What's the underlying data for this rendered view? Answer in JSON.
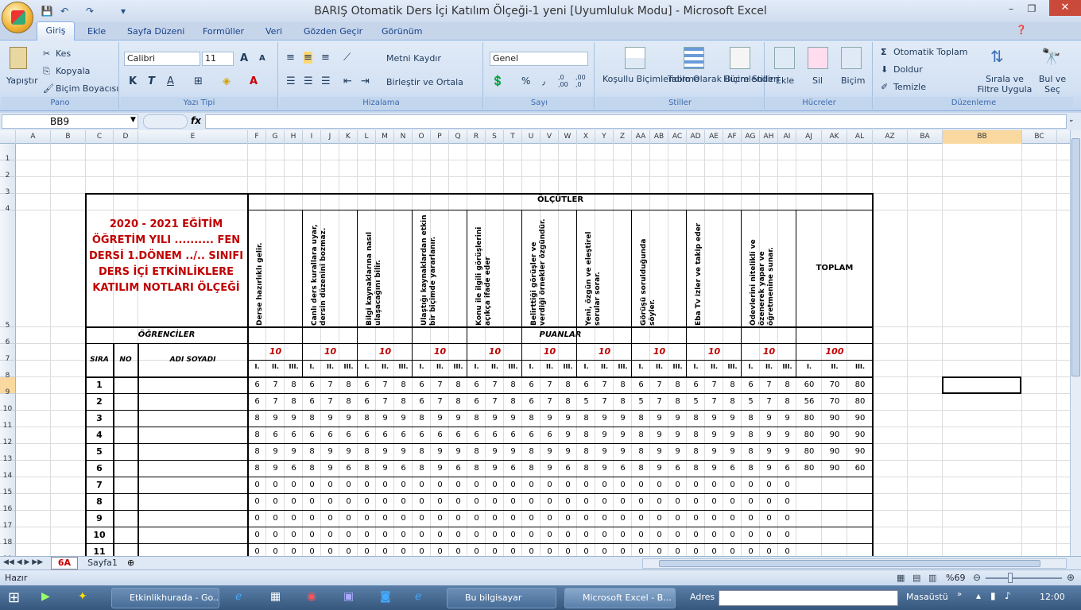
{
  "window": {
    "title": "BARIŞ Otomatik Ders İçi Katılım Ölçeği-1 yeni  [Uyumluluk Modu]  - Microsoft Excel",
    "minimize": "–",
    "restore": "❐",
    "close": "✕"
  },
  "ribbon_tabs": [
    "Giriş",
    "Ekle",
    "Sayfa Düzeni",
    "Formüller",
    "Veri",
    "Gözden Geçir",
    "Görünüm"
  ],
  "ribbon": {
    "clipboard": {
      "paste": "Yapıştır",
      "cut": "Kes",
      "copy": "Kopyala",
      "format_painter": "Biçim Boyacısı",
      "label": "Pano"
    },
    "font": {
      "name": "Calibri",
      "size": "11",
      "bold": "K",
      "italic": "T",
      "underline": "A",
      "color": "A",
      "grow": "A",
      "shrink": "A",
      "label": "Yazı Tipi"
    },
    "alignment": {
      "wrap": "Metni Kaydır",
      "merge": "Birleştir ve Ortala",
      "label": "Hizalama"
    },
    "number": {
      "format": "Genel",
      "percent": "%",
      "comma": "٫",
      "inc": ",0 ,00",
      "dec": ",00 ,0",
      "label": "Sayı"
    },
    "styles": {
      "conditional": "Koşullu Biçimlendirme",
      "table": "Tablo Olarak Biçimlendir",
      "cell": "Hücre Stilleri",
      "label": "Stiller"
    },
    "cells": {
      "insert": "Ekle",
      "delete": "Sil",
      "format": "Biçim",
      "label": "Hücreler"
    },
    "editing": {
      "autosum": "Otomatik Toplam",
      "fill": "Doldur",
      "clear": "Temizle",
      "sort": "Sırala ve Filtre Uygula",
      "find": "Bul ve Seç",
      "label": "Düzenleme"
    }
  },
  "formula_bar": {
    "name_box": "BB9",
    "fx": "fx",
    "formula": ""
  },
  "columns": [
    "A",
    "B",
    "C",
    "D",
    "E",
    "F",
    "G",
    "H",
    "I",
    "J",
    "K",
    "L",
    "M",
    "N",
    "O",
    "P",
    "Q",
    "R",
    "S",
    "T",
    "U",
    "V",
    "W",
    "X",
    "Y",
    "Z",
    "AA",
    "AB",
    "AC",
    "AD",
    "AE",
    "AF",
    "AG",
    "AH",
    "AI",
    "AJ",
    "AK",
    "AL",
    "AZ",
    "BA",
    "BB",
    "BC"
  ],
  "rows": [
    "1",
    "2",
    "3",
    "4",
    "5",
    "6",
    "7",
    "8",
    "9",
    "10",
    "11",
    "12",
    "13",
    "14",
    "15",
    "16",
    "17",
    "18",
    "19"
  ],
  "sheet": {
    "title_block": "2020 - 2021 EĞİTİM ÖĞRETİM YILI ..........  FEN DERSİ 1.DÖNEM ../.. SINIFI DERS İÇİ ETKİNLİKLERE KATILIM NOTLARI ÖLÇEĞİ",
    "olcutler": "ÖLÇÜTLER",
    "criteria": [
      "Derse hazırlıklı gelir.",
      "Canlı ders kurallara uyar, dersin düzenini bozmaz.",
      "Bilgi kaynaklarına nasıl ulaşacağını bilir.",
      "Ulaştığı kaynaklardan etkin bir biçimde yararlanır.",
      "Konu ile ilgili görüşlerini açıkça ifade eder",
      "Belirttiği görüşler ve verdiği örnekler özgündür.",
      "Yeni, özgün ve eleştirel sorular sorar.",
      "Görüşü sorulduğunda söyler.",
      "Eba Tv izler ve takip eder",
      "Ödevlerini nitelikli ve özenerek yapar ve öğretmenine sunar."
    ],
    "toplam": "TOPLAM",
    "ogrenciler": "ÖĞRENCİLER",
    "puanlar": "PUANLAR",
    "max_points": [
      "10",
      "10",
      "10",
      "10",
      "10",
      "10",
      "10",
      "10",
      "10",
      "10",
      "100"
    ],
    "hdr_sira": "SIRA",
    "hdr_no": "NO",
    "hdr_adi": "ADI SOYADI",
    "sub": [
      "I.",
      "II.",
      "III."
    ],
    "students": [
      {
        "sira": "1",
        "scores": [
          "6",
          "7",
          "8",
          "6",
          "7",
          "8",
          "6",
          "7",
          "8",
          "6",
          "7",
          "8",
          "6",
          "7",
          "8",
          "6",
          "7",
          "8",
          "6",
          "7",
          "8",
          "6",
          "7",
          "8",
          "6",
          "7",
          "8",
          "6",
          "7",
          "8"
        ],
        "totals": [
          "60",
          "70",
          "80"
        ]
      },
      {
        "sira": "2",
        "scores": [
          "6",
          "7",
          "8",
          "6",
          "7",
          "8",
          "6",
          "7",
          "8",
          "6",
          "7",
          "8",
          "6",
          "7",
          "8",
          "6",
          "7",
          "8",
          "5",
          "7",
          "8",
          "5",
          "7",
          "8",
          "5",
          "7",
          "8",
          "5",
          "7",
          "8"
        ],
        "totals": [
          "56",
          "70",
          "80"
        ]
      },
      {
        "sira": "3",
        "scores": [
          "8",
          "9",
          "9",
          "8",
          "9",
          "9",
          "8",
          "9",
          "9",
          "8",
          "9",
          "9",
          "8",
          "9",
          "9",
          "8",
          "9",
          "9",
          "8",
          "9",
          "9",
          "8",
          "9",
          "9",
          "8",
          "9",
          "9",
          "8",
          "9",
          "9"
        ],
        "totals": [
          "80",
          "90",
          "90"
        ]
      },
      {
        "sira": "4",
        "scores": [
          "8",
          "6",
          "6",
          "6",
          "6",
          "6",
          "6",
          "6",
          "6",
          "6",
          "6",
          "6",
          "6",
          "6",
          "6",
          "6",
          "6",
          "9",
          "8",
          "9",
          "9",
          "8",
          "9",
          "9",
          "8",
          "9",
          "9",
          "8",
          "9",
          "9"
        ],
        "totals": [
          "80",
          "90",
          "90"
        ]
      },
      {
        "sira": "5",
        "scores": [
          "8",
          "9",
          "9",
          "8",
          "9",
          "9",
          "8",
          "9",
          "9",
          "8",
          "9",
          "9",
          "8",
          "9",
          "9",
          "8",
          "9",
          "9",
          "8",
          "9",
          "9",
          "8",
          "9",
          "9",
          "8",
          "9",
          "9",
          "8",
          "9",
          "9"
        ],
        "totals": [
          "80",
          "90",
          "90"
        ]
      },
      {
        "sira": "6",
        "scores": [
          "8",
          "9",
          "6",
          "8",
          "9",
          "6",
          "8",
          "9",
          "6",
          "8",
          "9",
          "6",
          "8",
          "9",
          "6",
          "8",
          "9",
          "6",
          "8",
          "9",
          "6",
          "8",
          "9",
          "6",
          "8",
          "9",
          "6",
          "8",
          "9",
          "6"
        ],
        "totals": [
          "80",
          "90",
          "60"
        ]
      },
      {
        "sira": "7",
        "scores": [
          "0",
          "0",
          "0",
          "0",
          "0",
          "0",
          "0",
          "0",
          "0",
          "0",
          "0",
          "0",
          "0",
          "0",
          "0",
          "0",
          "0",
          "0",
          "0",
          "0",
          "0",
          "0",
          "0",
          "0",
          "0",
          "0",
          "0",
          "0",
          "0",
          "0"
        ],
        "totals": [
          "",
          "",
          ""
        ]
      },
      {
        "sira": "8",
        "scores": [
          "0",
          "0",
          "0",
          "0",
          "0",
          "0",
          "0",
          "0",
          "0",
          "0",
          "0",
          "0",
          "0",
          "0",
          "0",
          "0",
          "0",
          "0",
          "0",
          "0",
          "0",
          "0",
          "0",
          "0",
          "0",
          "0",
          "0",
          "0",
          "0",
          "0"
        ],
        "totals": [
          "",
          "",
          ""
        ]
      },
      {
        "sira": "9",
        "scores": [
          "0",
          "0",
          "0",
          "0",
          "0",
          "0",
          "0",
          "0",
          "0",
          "0",
          "0",
          "0",
          "0",
          "0",
          "0",
          "0",
          "0",
          "0",
          "0",
          "0",
          "0",
          "0",
          "0",
          "0",
          "0",
          "0",
          "0",
          "0",
          "0",
          "0"
        ],
        "totals": [
          "",
          "",
          ""
        ]
      },
      {
        "sira": "10",
        "scores": [
          "0",
          "0",
          "0",
          "0",
          "0",
          "0",
          "0",
          "0",
          "0",
          "0",
          "0",
          "0",
          "0",
          "0",
          "0",
          "0",
          "0",
          "0",
          "0",
          "0",
          "0",
          "0",
          "0",
          "0",
          "0",
          "0",
          "0",
          "0",
          "0",
          "0"
        ],
        "totals": [
          "",
          "",
          ""
        ]
      },
      {
        "sira": "11",
        "scores": [
          "0",
          "0",
          "0",
          "0",
          "0",
          "0",
          "0",
          "0",
          "0",
          "0",
          "0",
          "0",
          "0",
          "0",
          "0",
          "0",
          "0",
          "0",
          "0",
          "0",
          "0",
          "0",
          "0",
          "0",
          "0",
          "0",
          "0",
          "0",
          "0",
          "0"
        ],
        "totals": [
          "",
          "",
          ""
        ]
      }
    ]
  },
  "sheet_tabs": [
    "6A",
    "Sayfa1"
  ],
  "status": {
    "ready": "Hazır",
    "zoom": "%69"
  },
  "taskbar": {
    "items": [
      "Etkinlikhurada - Go...",
      "Bu bilgisayar",
      "Microsoft Excel - B..."
    ],
    "address_label": "Adres",
    "desktop": "Masaüstü",
    "clock": "12:00"
  }
}
